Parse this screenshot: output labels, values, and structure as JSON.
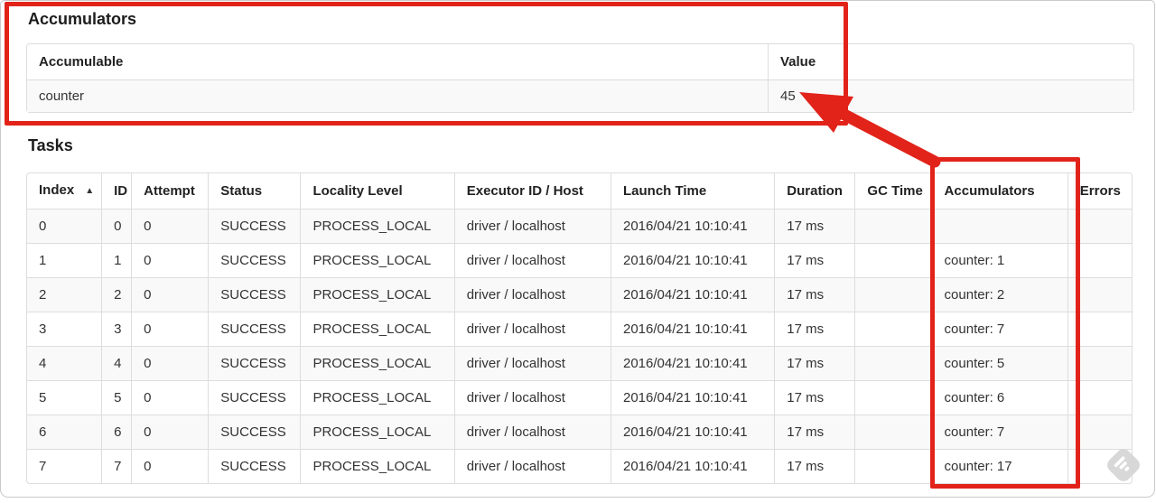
{
  "accumulators_section": {
    "title": "Accumulators",
    "table": {
      "headers": [
        "Accumulable",
        "Value"
      ],
      "rows": [
        [
          "counter",
          "45"
        ]
      ]
    }
  },
  "tasks_section": {
    "title": "Tasks",
    "table": {
      "headers": [
        "Index",
        "ID",
        "Attempt",
        "Status",
        "Locality Level",
        "Executor ID / Host",
        "Launch Time",
        "Duration",
        "GC Time",
        "Accumulators",
        "Errors"
      ],
      "sorted_header": "Index",
      "sort_glyph": "▲",
      "rows": [
        [
          "0",
          "0",
          "0",
          "SUCCESS",
          "PROCESS_LOCAL",
          "driver / localhost",
          "2016/04/21 10:10:41",
          "17 ms",
          "",
          "",
          ""
        ],
        [
          "1",
          "1",
          "0",
          "SUCCESS",
          "PROCESS_LOCAL",
          "driver / localhost",
          "2016/04/21 10:10:41",
          "17 ms",
          "",
          "counter: 1",
          ""
        ],
        [
          "2",
          "2",
          "0",
          "SUCCESS",
          "PROCESS_LOCAL",
          "driver / localhost",
          "2016/04/21 10:10:41",
          "17 ms",
          "",
          "counter: 2",
          ""
        ],
        [
          "3",
          "3",
          "0",
          "SUCCESS",
          "PROCESS_LOCAL",
          "driver / localhost",
          "2016/04/21 10:10:41",
          "17 ms",
          "",
          "counter: 7",
          ""
        ],
        [
          "4",
          "4",
          "0",
          "SUCCESS",
          "PROCESS_LOCAL",
          "driver / localhost",
          "2016/04/21 10:10:41",
          "17 ms",
          "",
          "counter: 5",
          ""
        ],
        [
          "5",
          "5",
          "0",
          "SUCCESS",
          "PROCESS_LOCAL",
          "driver / localhost",
          "2016/04/21 10:10:41",
          "17 ms",
          "",
          "counter: 6",
          ""
        ],
        [
          "6",
          "6",
          "0",
          "SUCCESS",
          "PROCESS_LOCAL",
          "driver / localhost",
          "2016/04/21 10:10:41",
          "17 ms",
          "",
          "counter: 7",
          ""
        ],
        [
          "7",
          "7",
          "0",
          "SUCCESS",
          "PROCESS_LOCAL",
          "driver / localhost",
          "2016/04/21 10:10:41",
          "17 ms",
          "",
          "counter: 17",
          ""
        ]
      ]
    }
  },
  "annotations": {
    "color": "#e2231a"
  },
  "colors": {
    "table_border": "#dddddd",
    "row_stripe": "#f9f9f9",
    "text": "#333333"
  }
}
